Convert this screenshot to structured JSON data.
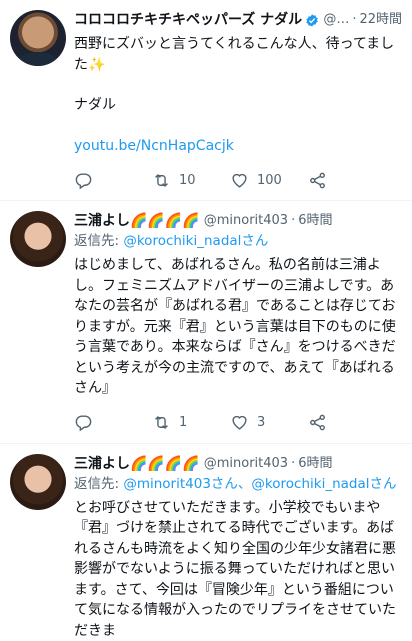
{
  "tweets": [
    {
      "name": "コロコロチキチキペッパーズ ナダル",
      "handle": "@…",
      "time": "22時間",
      "verified": true,
      "more": "···",
      "lines": [
        "西野にズバッと言うてくれるこんな人、待ってました✨",
        "",
        "ナダル",
        "",
        "youtu.be/NcnHapCacjk"
      ],
      "link": "youtu.be/NcnHapCacjk",
      "reply_count": "",
      "retweet_count": "10",
      "like_count": "100"
    },
    {
      "name": "三浦よし🌈🌈🌈🌈",
      "handle": "@minorit403",
      "time": "6時間",
      "reply_prefix": "返信先: ",
      "reply_mentions": "@korochiki_nadalさん",
      "text": "はじめまして、あばれるさん。私の名前は三浦よし。フェミニズムアドバイザーの三浦よしです。あなたの芸名が『あばれる君』であることは存じておりますが。元来『君』という言葉は目下のものに使う言葉であり。本来ならば『さん』をつけるべきだという考えが今の主流ですので、あえて『あばれるさん』",
      "reply_count": "",
      "retweet_count": "1",
      "like_count": "3"
    },
    {
      "name": "三浦よし🌈🌈🌈🌈",
      "handle": "@minorit403",
      "time": "6時間",
      "reply_prefix": "返信先: ",
      "reply_mentions": "@minorit403さん、@korochiki_nadalさん",
      "text": "とお呼びさせていただきます。小学校でもいまや『君』づけを禁止されてる時代でございます。あばれるさんも時流をよく知り全国の少年少女諸君に悪影響がでないように振る舞っていただければと思います。さて、今回は『冒険少年』という番組について気になる情報が入ったのでリプライをさせていただきま"
    }
  ],
  "colors": {
    "accent": "#1d9bf0",
    "muted": "#536471",
    "text": "#0f1419"
  }
}
